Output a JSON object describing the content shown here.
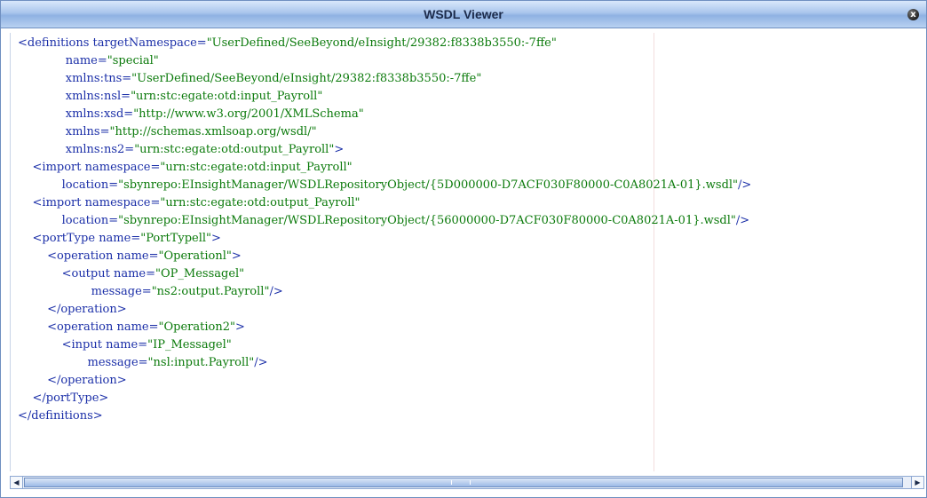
{
  "window": {
    "title": "WSDL Viewer",
    "close_label": "x"
  },
  "code_lines": [
    [
      [
        "tag",
        "<definitions "
      ],
      [
        "attr",
        "targetNamespace="
      ],
      [
        "val",
        "\"UserDefined/SeeBeyond/eInsight/29382:f8338b3550:-7ffe\""
      ]
    ],
    [
      [
        "pad",
        "             "
      ],
      [
        "attr",
        "name="
      ],
      [
        "val",
        "\"special\""
      ]
    ],
    [
      [
        "pad",
        "             "
      ],
      [
        "attr",
        "xmlns:tns="
      ],
      [
        "val",
        "\"UserDefined/SeeBeyond/eInsight/29382:f8338b3550:-7ffe\""
      ]
    ],
    [
      [
        "pad",
        "             "
      ],
      [
        "attr",
        "xmlns:nsl="
      ],
      [
        "val",
        "\"urn:stc:egate:otd:input_Payroll\""
      ]
    ],
    [
      [
        "pad",
        "             "
      ],
      [
        "attr",
        "xmlns:xsd="
      ],
      [
        "val",
        "\"http://www.w3.org/2001/XMLSchema\""
      ]
    ],
    [
      [
        "pad",
        "             "
      ],
      [
        "attr",
        "xmlns="
      ],
      [
        "val",
        "\"http://schemas.xmlsoap.org/wsdl/\""
      ]
    ],
    [
      [
        "pad",
        "             "
      ],
      [
        "attr",
        "xmlns:ns2="
      ],
      [
        "val",
        "\"urn:stc:egate:otd:output_Payroll\""
      ],
      [
        "tag",
        ">"
      ]
    ],
    [
      [
        "pad",
        "    "
      ],
      [
        "tag",
        "<import "
      ],
      [
        "attr",
        "namespace="
      ],
      [
        "val",
        "\"urn:stc:egate:otd:input_Payroll\""
      ]
    ],
    [
      [
        "pad",
        "            "
      ],
      [
        "attr",
        "location="
      ],
      [
        "val",
        "\"sbynrepo:EInsightManager/WSDLRepositoryObject/{5D000000-D7ACF030F80000-C0A8021A-01}.wsdl\""
      ],
      [
        "tag",
        "/>"
      ]
    ],
    [
      [
        "pad",
        "    "
      ],
      [
        "tag",
        "<import "
      ],
      [
        "attr",
        "namespace="
      ],
      [
        "val",
        "\"urn:stc:egate:otd:output_Payroll\""
      ]
    ],
    [
      [
        "pad",
        "            "
      ],
      [
        "attr",
        "location="
      ],
      [
        "val",
        "\"sbynrepo:EInsightManager/WSDLRepositoryObject/{56000000-D7ACF030F80000-C0A8021A-01}.wsdl\""
      ],
      [
        "tag",
        "/>"
      ]
    ],
    [
      [
        "pad",
        "    "
      ],
      [
        "tag",
        "<portType "
      ],
      [
        "attr",
        "name="
      ],
      [
        "val",
        "\"PortTypell\""
      ],
      [
        "tag",
        ">"
      ]
    ],
    [
      [
        "pad",
        "        "
      ],
      [
        "tag",
        "<operation "
      ],
      [
        "attr",
        "name="
      ],
      [
        "val",
        "\"Operationl\""
      ],
      [
        "tag",
        ">"
      ]
    ],
    [
      [
        "pad",
        "            "
      ],
      [
        "tag",
        "<output "
      ],
      [
        "attr",
        "name="
      ],
      [
        "val",
        "\"OP_Messagel\""
      ]
    ],
    [
      [
        "pad",
        "                    "
      ],
      [
        "attr",
        "message="
      ],
      [
        "val",
        "\"ns2:output.Payroll\""
      ],
      [
        "tag",
        "/>"
      ]
    ],
    [
      [
        "pad",
        "        "
      ],
      [
        "tag",
        "</operation>"
      ]
    ],
    [
      [
        "pad",
        "        "
      ],
      [
        "tag",
        "<operation "
      ],
      [
        "attr",
        "name="
      ],
      [
        "val",
        "\"Operation2\""
      ],
      [
        "tag",
        ">"
      ]
    ],
    [
      [
        "pad",
        "            "
      ],
      [
        "tag",
        "<input "
      ],
      [
        "attr",
        "name="
      ],
      [
        "val",
        "\"IP_Messagel\""
      ]
    ],
    [
      [
        "pad",
        "                   "
      ],
      [
        "attr",
        "message="
      ],
      [
        "val",
        "\"nsl:input.Payroll\""
      ],
      [
        "tag",
        "/>"
      ]
    ],
    [
      [
        "pad",
        "        "
      ],
      [
        "tag",
        "</operation>"
      ]
    ],
    [
      [
        "pad",
        "    "
      ],
      [
        "tag",
        "</portType>"
      ]
    ],
    [
      [
        "tag",
        "</definitions>"
      ]
    ]
  ],
  "colors": {
    "tag": "#1b2fa8",
    "attr": "#1b2fa8",
    "val": "#0b7a0b"
  }
}
